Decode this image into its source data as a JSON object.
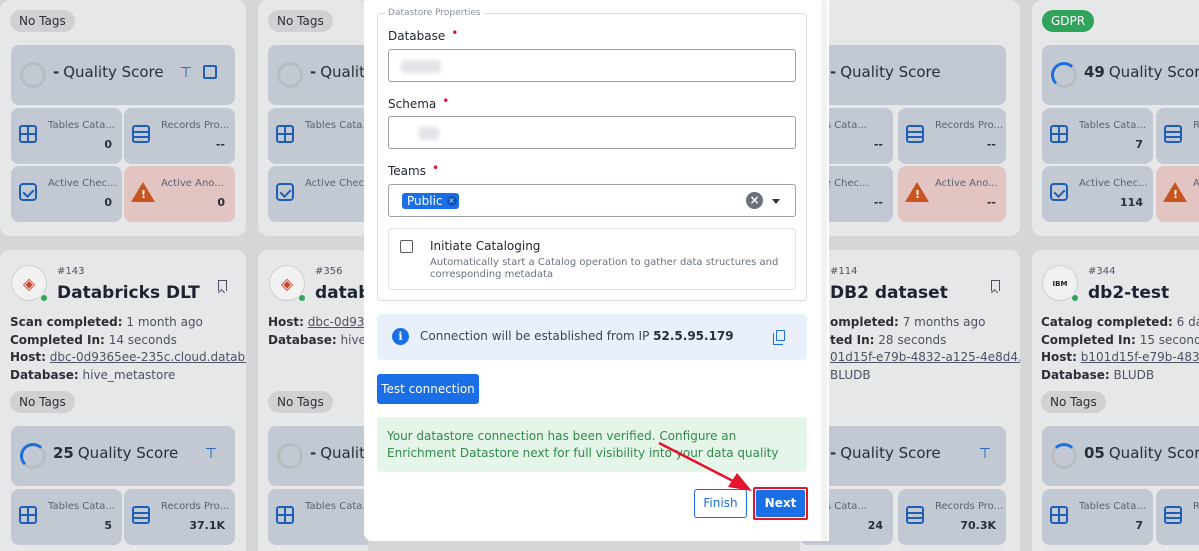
{
  "background": {
    "top_cards": [
      {
        "tag": "No Tags",
        "score_value": "-",
        "score_label": "Quality Score",
        "tables_label": "Tables Cata...",
        "tables_value": "0",
        "records_label": "Records Pro...",
        "records_value": "--",
        "checks_label": "Active Chec...",
        "checks_value": "0",
        "anom_label": "Active Ano...",
        "anom_value": "0"
      },
      {
        "tag": "No Tags",
        "score_value": "-",
        "score_label": "Qualit",
        "tables_label": "Tables Cata...",
        "tables_value": "--",
        "records_label": "Records Pro...",
        "records_value": "",
        "checks_label": "Active Chec...",
        "checks_value": "--",
        "anom_label": "",
        "anom_value": ""
      },
      {
        "tag": "",
        "score_value": "-",
        "score_label": "Quality Score",
        "tables_label": "Tables Cata...",
        "tables_value": "--",
        "records_label": "Records Pro...",
        "records_value": "--",
        "checks_label": "Active Chec...",
        "checks_value": "--",
        "anom_label": "Active Ano...",
        "anom_value": "--"
      },
      {
        "tag": "GDPR",
        "score_value": "49",
        "score_label": "Quality Score",
        "tables_label": "Tables Cata...",
        "tables_value": "7",
        "records_label": "Re",
        "records_value": "",
        "checks_label": "Active Chec...",
        "checks_value": "114",
        "anom_label": "Ac",
        "anom_value": ""
      }
    ],
    "bottom_cards": [
      {
        "id": "#143",
        "title": "Databricks DLT",
        "meta": [
          {
            "k": "Scan completed:",
            "v": "1 month ago"
          },
          {
            "k": "Completed In:",
            "v": "14 seconds"
          },
          {
            "k": "Host:",
            "v": "dbc-0d9365ee-235c.cloud.databr..."
          },
          {
            "k": "Database:",
            "v": "hive_metastore"
          }
        ],
        "tag": "No Tags",
        "score_value": "25",
        "score_label": "Quality Score",
        "tables_label": "Tables Cata...",
        "tables_value": "5",
        "records_label": "Records Pro...",
        "records_value": "37.1K"
      },
      {
        "id": "#356",
        "title": "datab",
        "meta": [
          {
            "k": "Host:",
            "v": "dbc-0d9365"
          },
          {
            "k": "Database:",
            "v": "hive_m"
          }
        ],
        "tag": "No Tags",
        "score_value": "-",
        "score_label": "Qualit",
        "tables_label": "Tables Cata...",
        "tables_value": "",
        "records_label": "",
        "records_value": ""
      },
      {
        "id": "#114",
        "title": "DB2 dataset",
        "meta": [
          {
            "k": "ompleted:",
            "v": "7 months ago"
          },
          {
            "k": "ted In:",
            "v": "28 seconds"
          },
          {
            "k": "",
            "v": "01d15f-e79b-4832-a125-4e8d4..."
          },
          {
            "k": "",
            "v": "BLUDB"
          }
        ],
        "tag": "",
        "score_value": "-",
        "score_label": "Quality Score",
        "tables_label": "Tables Cata...",
        "tables_value": "24",
        "records_label": "Records Pro...",
        "records_value": "70.3K"
      },
      {
        "id": "#344",
        "title": "db2-test",
        "meta": [
          {
            "k": "Catalog completed:",
            "v": "6 days a"
          },
          {
            "k": "Completed In:",
            "v": "15 seconds"
          },
          {
            "k": "Host:",
            "v": "b101d15f-e79b-4832-a1"
          },
          {
            "k": "Database:",
            "v": "BLUDB"
          }
        ],
        "tag": "No Tags",
        "score_value": "05",
        "score_label": "Quality Score",
        "tables_label": "Tables Cata...",
        "tables_value": "7",
        "records_label": "Re",
        "records_value": ""
      }
    ]
  },
  "modal": {
    "section_legend": "Datastore Properties",
    "database_label": "Database",
    "schema_label": "Schema",
    "teams_label": "Teams",
    "required_mark": "•",
    "team_chip": "Public",
    "chip_remove": "×",
    "clear_icon": "×",
    "catalog_title": "Initiate Cataloging",
    "catalog_desc": "Automatically start a Catalog operation to gather data structures and corresponding metadata",
    "ip_text": "Connection will be established from IP",
    "ip_value": "52.5.95.179",
    "info_glyph": "i",
    "test_button": "Test connection",
    "success_message": "Your datastore connection has been verified. Configure an Enrichment Datastore next for full visibility into your data quality",
    "finish_button": "Finish",
    "next_button": "Next"
  },
  "colors": {
    "accent": "#1a6fe6",
    "highlight": "#e3142c",
    "success_bg": "#e6f5e9",
    "success_text": "#2f8a4a"
  }
}
